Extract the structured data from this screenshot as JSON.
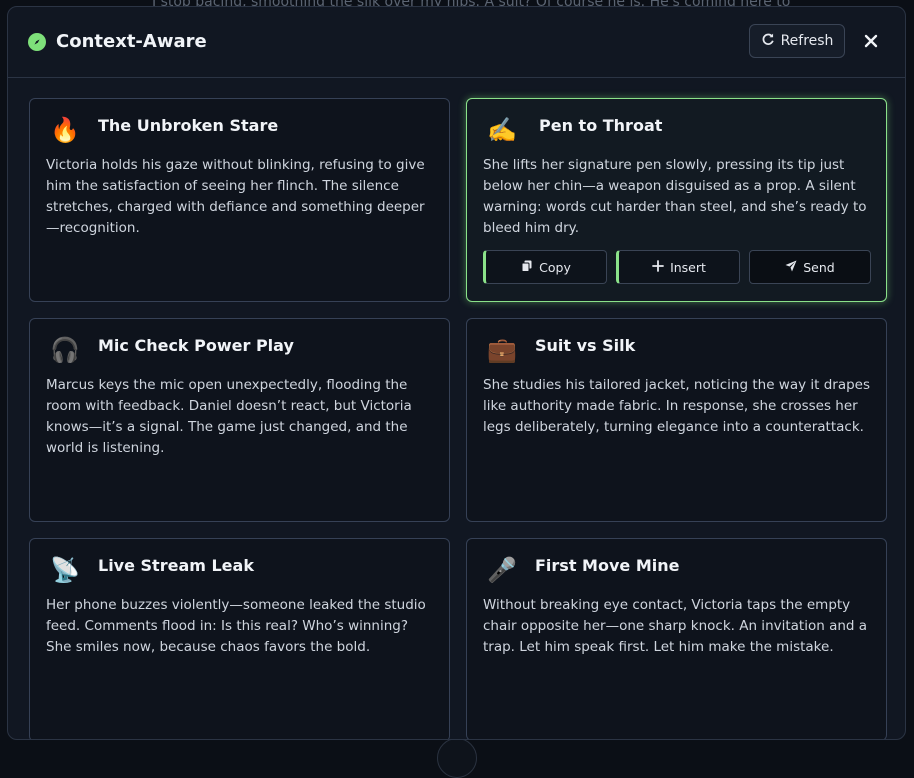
{
  "backdrop": {
    "text": "I stop pacing, smoothing the silk over my hips. A suit? Of course he is. He's coming here to"
  },
  "header": {
    "title": "Context-Aware",
    "logo_icon": "compass-icon",
    "refresh_label": "Refresh",
    "close_icon": "close-icon"
  },
  "colors": {
    "accent": "#7ee07a",
    "background": "#111722",
    "card_border": "#364156"
  },
  "cards": [
    {
      "emoji": "🔥",
      "icon": "fire-icon",
      "title": "The Unbroken Stare",
      "body": "Victoria holds his gaze without blinking, refusing to give him the satisfaction of seeing her flinch. The silence stretches, charged with defiance and something deeper—recognition."
    },
    {
      "emoji": "✍️",
      "icon": "writing-hand-icon",
      "title": "Pen to Throat",
      "body": "She lifts her signature pen slowly, pressing its tip just below her chin—a weapon disguised as a prop. A silent warning: words cut harder than steel, and she’s ready to bleed him dry.",
      "active": true
    },
    {
      "emoji": "🎧",
      "icon": "headphones-icon",
      "title": "Mic Check Power Play",
      "body": "Marcus keys the mic open unexpectedly, flooding the room with feedback. Daniel doesn’t react, but Victoria knows—it’s a signal. The game just changed, and the world is listening."
    },
    {
      "emoji": "💼",
      "icon": "briefcase-icon",
      "title": "Suit vs Silk",
      "body": "She studies his tailored jacket, noticing the way it drapes like authority made fabric. In response, she crosses her legs deliberately, turning elegance into a counterattack."
    },
    {
      "emoji": "📡",
      "icon": "satellite-dish-icon",
      "title": "Live Stream Leak",
      "body": "Her phone buzzes violently—someone leaked the studio feed. Comments flood in: Is this real? Who’s winning? She smiles now, because chaos favors the bold."
    },
    {
      "emoji": "🎤",
      "icon": "microphone-icon",
      "title": "First Move Mine",
      "body": "Without breaking eye contact, Victoria taps the empty chair opposite her—one sharp knock. An invitation and a trap. Let him speak first. Let him make the mistake."
    }
  ],
  "actions": {
    "copy_label": "Copy",
    "insert_label": "Insert",
    "send_label": "Send"
  }
}
